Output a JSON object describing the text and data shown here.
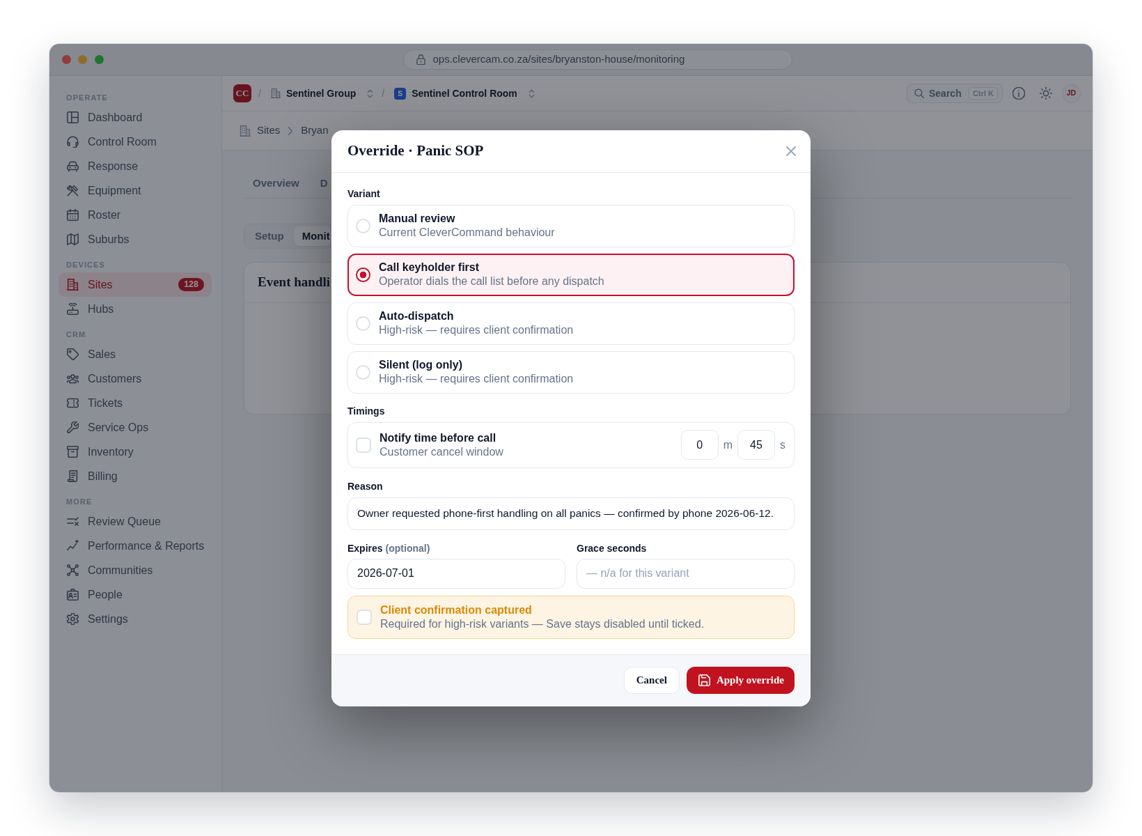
{
  "browser": {
    "url": "ops.clevercam.co.za/sites/bryanston-house/monitoring"
  },
  "sidebar": {
    "sections": [
      {
        "label": "OPERATE",
        "items": [
          {
            "label": "Dashboard",
            "selected": false
          },
          {
            "label": "Control Room",
            "selected": false
          },
          {
            "label": "Response",
            "selected": false
          },
          {
            "label": "Equipment",
            "selected": false
          },
          {
            "label": "Roster",
            "selected": false
          },
          {
            "label": "Suburbs",
            "selected": false
          }
        ]
      },
      {
        "label": "DEVICES",
        "items": [
          {
            "label": "Sites",
            "selected": true,
            "badge": "128"
          },
          {
            "label": "Hubs",
            "selected": false
          }
        ]
      },
      {
        "label": "CRM",
        "items": [
          {
            "label": "Sales",
            "selected": false
          },
          {
            "label": "Customers",
            "selected": false
          },
          {
            "label": "Tickets",
            "selected": false
          },
          {
            "label": "Service Ops",
            "selected": false
          },
          {
            "label": "Inventory",
            "selected": false
          },
          {
            "label": "Billing",
            "selected": false
          }
        ]
      },
      {
        "label": "MORE",
        "items": [
          {
            "label": "Review Queue",
            "selected": false
          },
          {
            "label": "Performance & Reports",
            "selected": false
          },
          {
            "label": "Communities",
            "selected": false
          },
          {
            "label": "People",
            "selected": false
          },
          {
            "label": "Settings",
            "selected": false
          }
        ]
      }
    ]
  },
  "topbar": {
    "items": [
      {
        "kind": "logo",
        "label": "CC"
      },
      {
        "kind": "separator",
        "label": "/"
      },
      {
        "kind": "switcher",
        "label": "Sentinel Group"
      },
      {
        "kind": "separator",
        "label": "/"
      },
      {
        "kind": "switcher",
        "label": "Sentinel Control Room",
        "badge": "S"
      }
    ],
    "search": {
      "label": "Search",
      "shortcut": "Ctrl K"
    },
    "avatar": "JD"
  },
  "breadcrumb": [
    "Sites",
    "Bryan"
  ],
  "tabs": [
    "Overview",
    "D"
  ],
  "segments": [
    {
      "label": "Setup",
      "selected": false
    },
    {
      "label": "Monit",
      "selected": true
    }
  ],
  "card": {
    "title": "Event handli"
  },
  "dialog": {
    "title": "Override · Panic SOP",
    "variant_label": "Variant",
    "variants": [
      {
        "title": "Manual review",
        "description": "Current CleverCommand behaviour",
        "selected": false
      },
      {
        "title": "Call keyholder first",
        "description": "Operator dials the call list before any dispatch",
        "selected": true
      },
      {
        "title": "Auto-dispatch",
        "description": "High-risk — requires client confirmation",
        "selected": false
      },
      {
        "title": "Silent (log only)",
        "description": "High-risk — requires client confirmation",
        "selected": false
      }
    ],
    "timings_label": "Timings",
    "timing": {
      "title": "Notify time before call",
      "description": "Customer cancel window",
      "checked": false,
      "minutes": "0",
      "minutes_unit": "m",
      "seconds": "45",
      "seconds_unit": "s"
    },
    "reason_label": "Reason",
    "reason": "Owner requested phone-first handling on all panics — confirmed by phone 2026-06-12.",
    "expires_label": "Expires",
    "expires_hint": "(optional)",
    "expires": "2026-07-01",
    "grace_label": "Grace seconds",
    "grace_placeholder": "— n/a for this variant",
    "confirmation": {
      "title": "Client confirmation captured",
      "description": "Required for high-risk variants — Save stays disabled until ticked.",
      "checked": false
    },
    "buttons": [
      {
        "label": "Cancel",
        "kind": "secondary"
      },
      {
        "label": "Apply override",
        "kind": "primary"
      }
    ]
  }
}
